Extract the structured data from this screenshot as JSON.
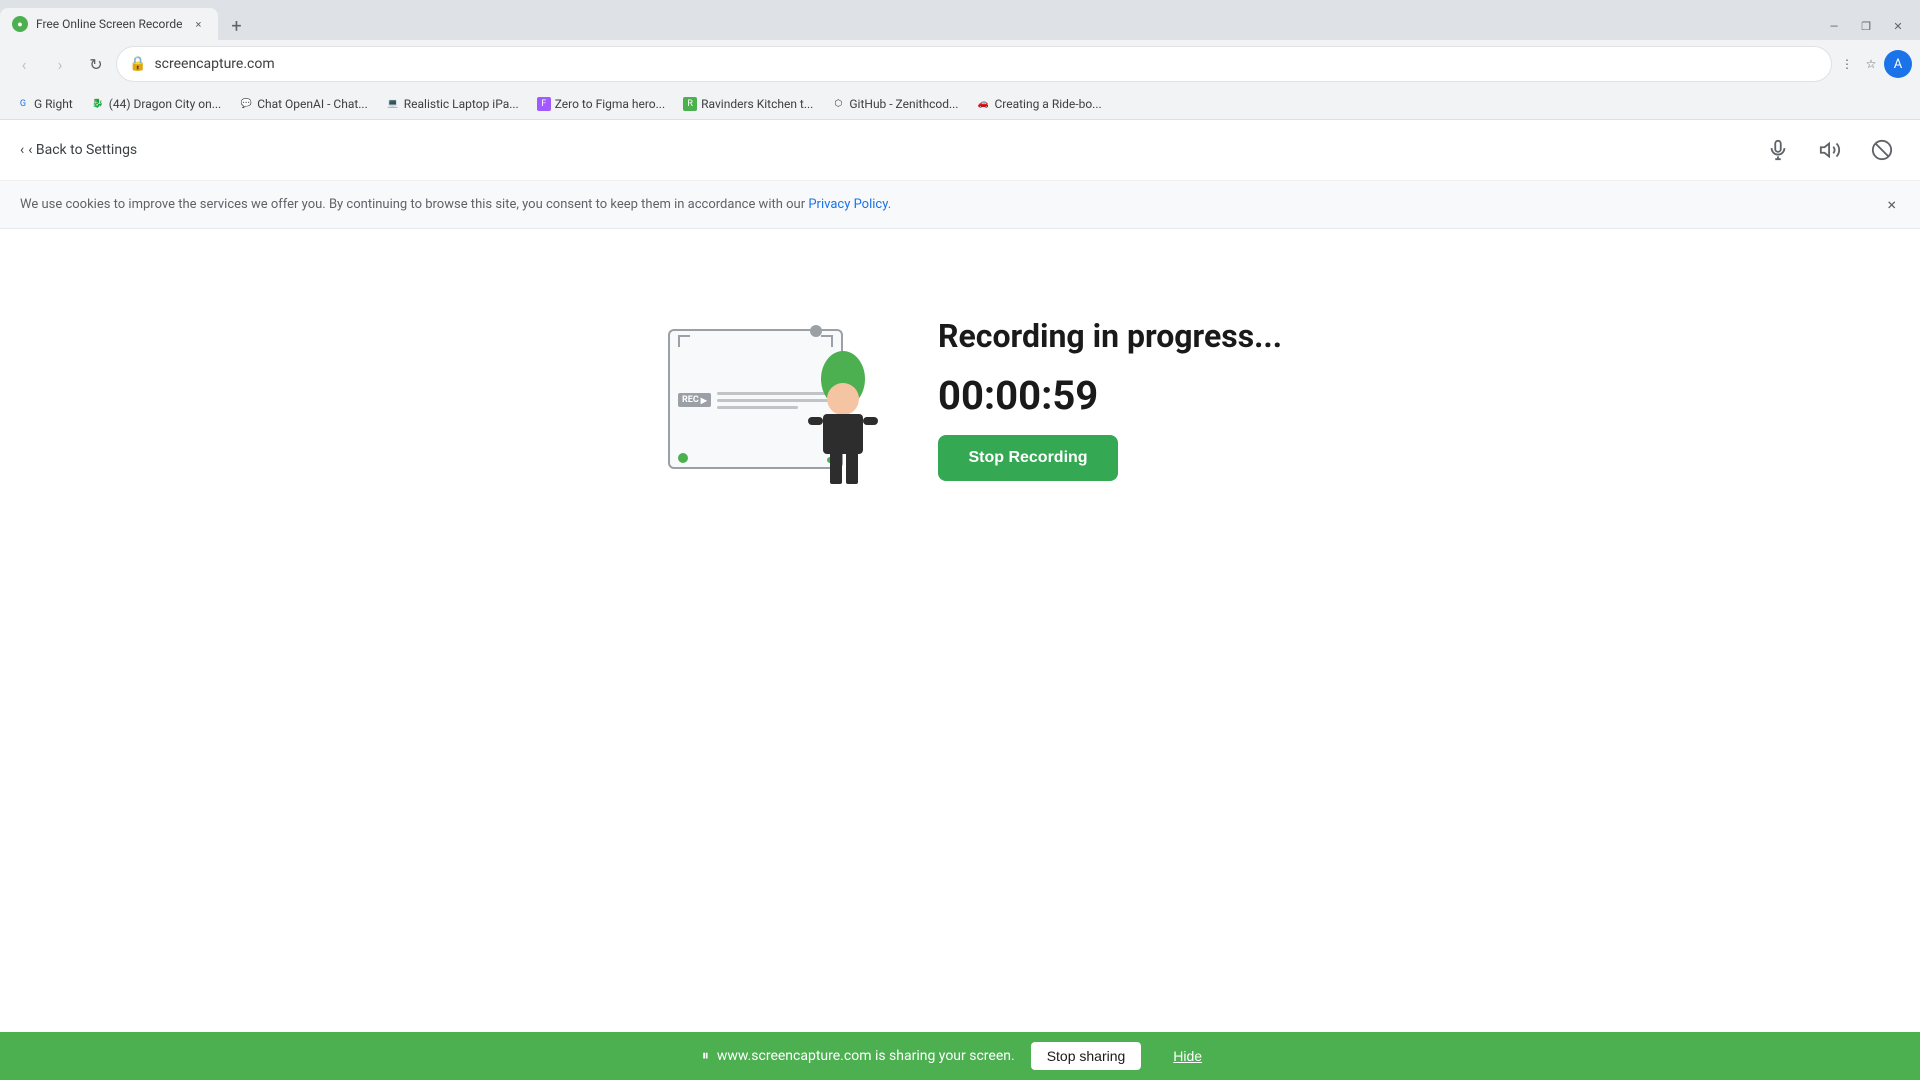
{
  "browser": {
    "tab": {
      "favicon_color": "#4caf50",
      "title": "Free Online Screen Recorde",
      "close_label": "×"
    },
    "new_tab_label": "+",
    "nav": {
      "back_label": "‹",
      "forward_label": "›",
      "reload_label": "↻",
      "url": "screencapture.com"
    },
    "bookmarks": [
      {
        "label": "G Right",
        "icon": "G"
      },
      {
        "label": "(44) Dragon City on...",
        "icon": "🐉"
      },
      {
        "label": "Chat OpenAI - Chat...",
        "icon": "💬"
      },
      {
        "label": "Realistic Laptop iPa...",
        "icon": "💻"
      },
      {
        "label": "Zero to Figma hero...",
        "icon": "F"
      },
      {
        "label": "Ravinders Kitchen t...",
        "icon": "R"
      },
      {
        "label": "GitHub - Zenithcod...",
        "icon": "⬡"
      },
      {
        "label": "Creating a Ride-bo...",
        "icon": "🚗"
      }
    ]
  },
  "top_bar": {
    "back_link": "‹ Back to Settings",
    "icons": {
      "mic": "🎙",
      "speaker": "🔊",
      "block": "⊘"
    }
  },
  "cookie_banner": {
    "text": "We use cookies to improve the services we offer you. By continuing to browse this site, you consent to keep them in accordance with our ",
    "link_text": "Privacy Policy.",
    "close_label": "×"
  },
  "recording": {
    "status": "Recording in progress...",
    "timer": "00:00:59",
    "stop_button_label": "Stop Recording"
  },
  "screen_share_bar": {
    "pause_icon": "⏸",
    "text": "www.screencapture.com is sharing your screen.",
    "stop_button_label": "Stop sharing",
    "hide_button_label": "Hide"
  }
}
